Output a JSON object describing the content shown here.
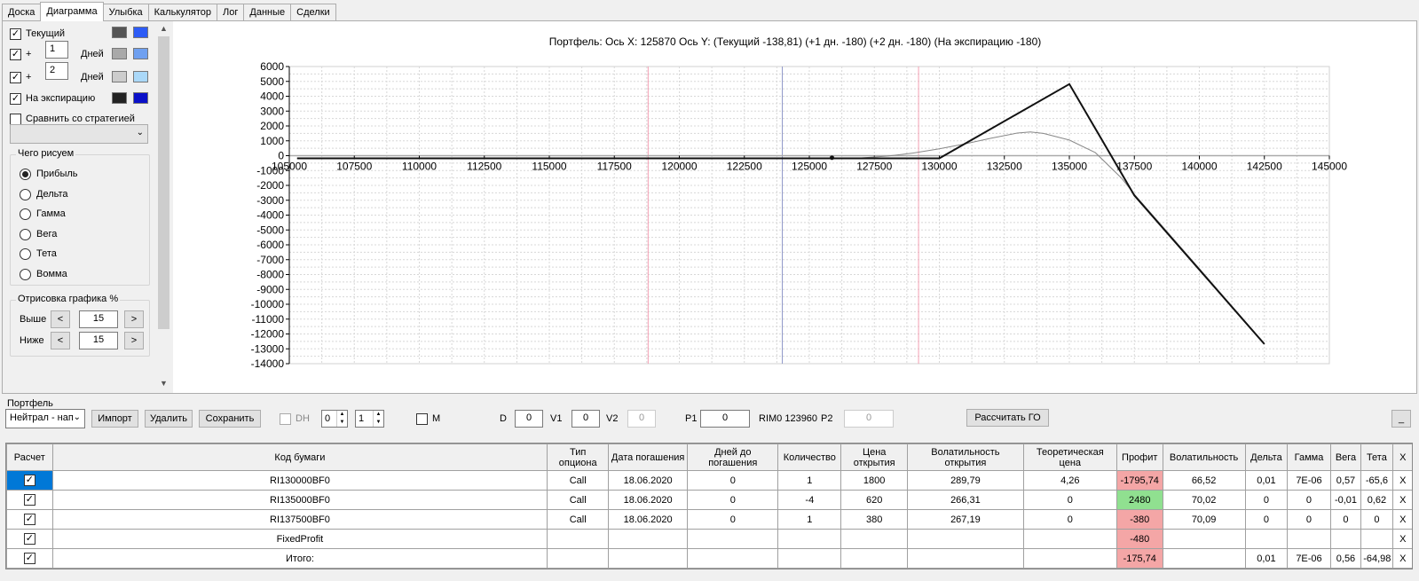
{
  "tabs": [
    {
      "label": "Доска",
      "active": false
    },
    {
      "label": "Диаграмма",
      "active": true
    },
    {
      "label": "Улыбка",
      "active": false
    },
    {
      "label": "Калькулятор",
      "active": false
    },
    {
      "label": "Лог",
      "active": false
    },
    {
      "label": "Данные",
      "active": false
    },
    {
      "label": "Сделки",
      "active": false
    }
  ],
  "left_panel": {
    "current_label": "Текущий",
    "plus1": {
      "sign": "+",
      "value": "1",
      "unit": "Дней"
    },
    "plus2": {
      "sign": "+",
      "value": "2",
      "unit": "Дней"
    },
    "expiration_label": "На экспирацию",
    "compare_label": "Сравнить со стратегией",
    "draw_group_title": "Чего рисуем",
    "radios": [
      {
        "label": "Прибыль",
        "checked": true
      },
      {
        "label": "Дельта",
        "checked": false
      },
      {
        "label": "Гамма",
        "checked": false
      },
      {
        "label": "Вега",
        "checked": false
      },
      {
        "label": "Тета",
        "checked": false
      },
      {
        "label": "Вомма",
        "checked": false
      }
    ],
    "render_group_title": "Отрисовка графика %",
    "above_label": "Выше",
    "above_value": "15",
    "below_label": "Ниже",
    "below_value": "15",
    "dec": "<",
    "inc": ">",
    "swatch_colors": {
      "current": [
        "#555555",
        "#2d5cf6"
      ],
      "plus1": [
        "#a9a9a9",
        "#6fa0f0"
      ],
      "plus2": [
        "#cccccc",
        "#aad8f8"
      ],
      "expiration": [
        "#222222",
        "#0a10c8"
      ]
    }
  },
  "chart_title": "Портфель: Ось X: 125870 Ось Y:  (Текущий -138,81)  (+1 дн. -180)  (+2 дн. -180)  (На экспирацию -180)",
  "chart_data": {
    "type": "line",
    "x_ticks": [
      105000,
      107500,
      110000,
      112500,
      115000,
      117500,
      120000,
      122500,
      125000,
      127500,
      130000,
      132500,
      135000,
      137500,
      140000,
      142500,
      145000
    ],
    "y_ticks": [
      6000,
      5000,
      4000,
      3000,
      2000,
      1000,
      0,
      -1000,
      -2000,
      -3000,
      -4000,
      -5000,
      -6000,
      -7000,
      -8000,
      -9000,
      -10000,
      -11000,
      -12000,
      -13000,
      -14000
    ],
    "xlim": [
      105000,
      145000
    ],
    "ylim": [
      -14000,
      6000
    ],
    "vertical_lines": [
      {
        "x": 118800,
        "color": "#f4a0b4"
      },
      {
        "x": 123960,
        "color": "#8f98c8"
      },
      {
        "x": 129200,
        "color": "#f4a0b4"
      }
    ],
    "series": [
      {
        "color": "#111111",
        "points": [
          [
            105300,
            -180
          ],
          [
            130000,
            -180
          ],
          [
            135000,
            4820
          ],
          [
            137500,
            -2680
          ],
          [
            142500,
            -12680
          ]
        ]
      },
      {
        "color": "#888888",
        "points": [
          [
            105300,
            -180
          ],
          [
            126000,
            -180
          ],
          [
            127000,
            -150
          ],
          [
            128000,
            -30
          ],
          [
            129000,
            180
          ],
          [
            130000,
            460
          ],
          [
            131000,
            800
          ],
          [
            132000,
            1180
          ],
          [
            133000,
            1520
          ],
          [
            133500,
            1600
          ],
          [
            134000,
            1500
          ],
          [
            135000,
            1050
          ],
          [
            136000,
            200
          ],
          [
            137000,
            -1500
          ],
          [
            137500,
            -2600
          ],
          [
            140000,
            -7600
          ],
          [
            142500,
            -12650
          ]
        ]
      }
    ],
    "markers": [
      [
        125870,
        -139
      ]
    ],
    "grid": true
  },
  "portfolio": {
    "section_label": "Портфель",
    "strategy_combo": "Нейтрал - нап",
    "import_label": "Импорт",
    "delete_label": "Удалить",
    "save_label": "Сохранить",
    "dh_label": "DH",
    "dh_spin1": "0",
    "dh_spin2": "1",
    "m_label": "M",
    "d_label": "D",
    "d_value": "0",
    "v1_label": "V1",
    "v1_value": "0",
    "v2_label": "V2",
    "v2_value": "0",
    "p1_label": "P1",
    "p1_value": "0",
    "rim_label": "RIM0 123960",
    "p2_label": "P2",
    "p2_value": "0",
    "calc_go_label": "Рассчитать ГО",
    "minimize_label": "_"
  },
  "table": {
    "headers": [
      "Расчет",
      "Код бумаги",
      "Тип опциона",
      "Дата погашения",
      "Дней до погашения",
      "Количество",
      "Цена открытия",
      "Волатильность открытия",
      "Теоретическая цена",
      "Профит",
      "Волатильность",
      "Дельта",
      "Гамма",
      "Вега",
      "Тета",
      "X"
    ],
    "rows": [
      {
        "checked": true,
        "cells": [
          "RI130000BF0",
          "Call",
          "18.06.2020",
          "0",
          "1",
          "1800",
          "289,79",
          "4,26",
          "-1795,74",
          "66,52",
          "0,01",
          "7E-06",
          "0,57",
          "-65,6",
          "X"
        ],
        "profit_state": "neg",
        "selected": true
      },
      {
        "checked": true,
        "cells": [
          "RI135000BF0",
          "Call",
          "18.06.2020",
          "0",
          "-4",
          "620",
          "266,31",
          "0",
          "2480",
          "70,02",
          "0",
          "0",
          "-0,01",
          "0,62",
          "X"
        ],
        "profit_state": "pos",
        "selected": false
      },
      {
        "checked": true,
        "cells": [
          "RI137500BF0",
          "Call",
          "18.06.2020",
          "0",
          "1",
          "380",
          "267,19",
          "0",
          "-380",
          "70,09",
          "0",
          "0",
          "0",
          "0",
          "X"
        ],
        "profit_state": "neg",
        "selected": false
      },
      {
        "checked": true,
        "cells": [
          "FixedProfit",
          "",
          "",
          "",
          "",
          "",
          "",
          "",
          "-480",
          "",
          "",
          "",
          "",
          "",
          "X"
        ],
        "profit_state": "neg",
        "selected": false
      },
      {
        "checked": true,
        "cells": [
          "Итого:",
          "",
          "",
          "",
          "",
          "",
          "",
          "",
          "-175,74",
          "",
          "0,01",
          "7E-06",
          "0,56",
          "-64,98",
          "X"
        ],
        "profit_state": "neg",
        "selected": false
      }
    ]
  }
}
